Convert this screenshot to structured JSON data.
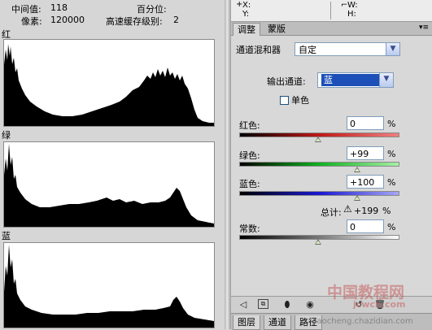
{
  "stats": {
    "mean_label": "中间值:",
    "mean_value": "118",
    "pixels_label": "像素:",
    "pixels_value": "120000",
    "percentile_label": "百分位:",
    "cache_label": "高速缓存级别:",
    "cache_value": "2"
  },
  "histograms": {
    "red_label": "红",
    "green_label": "绿",
    "blue_label": "蓝"
  },
  "info_bar": {
    "x_label": "X:",
    "y_label": "Y:",
    "w_label": "W:",
    "h_label": "H:"
  },
  "tabs": {
    "adjustments": "调整",
    "masks": "蒙版"
  },
  "mixer": {
    "preset_label": "通道混和器",
    "preset_value": "自定",
    "output_label": "输出通道:",
    "output_value": "蓝",
    "mono_label": "单色",
    "mono_checked": false,
    "red_label": "红色:",
    "red_value": "0",
    "green_label": "绿色:",
    "green_value": "+99",
    "blue_label": "蓝色:",
    "blue_value": "+100",
    "total_label": "总计:",
    "total_value": "+199",
    "percent": "%",
    "constant_label": "常数:",
    "constant_value": "0"
  },
  "slider_levels": {
    "red": 0,
    "green": 99,
    "blue": 100,
    "constant": 0
  },
  "colors": {
    "red_slider": "#c01818",
    "green_slider": "#10b020",
    "blue_slider": "#1818d0",
    "constant_slider": "#555555",
    "select_highlight": "#1c4fb8"
  },
  "toolbar_icons": [
    "back-arrow-icon",
    "clip-to-layer-icon",
    "visibility-eye-icon",
    "reset-icon",
    "delete-icon"
  ],
  "bottom_tabs": {
    "layers": "图层",
    "channels": "通道",
    "paths": "路径"
  },
  "watermark": {
    "site_cn": "中国教程网",
    "site_url": "jcwcn.com",
    "site_url2": "jiaocheng.chazidian.com"
  }
}
